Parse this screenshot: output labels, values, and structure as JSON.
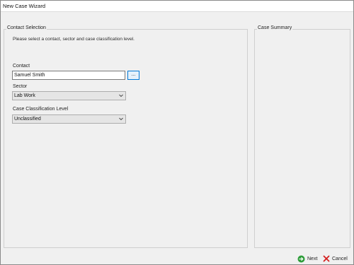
{
  "window": {
    "title": "New Case Wizard"
  },
  "contact_section": {
    "title": "Contact Selection",
    "instruction": "Please select a contact, sector and case classification level.",
    "contact_label": "Contact",
    "contact_value": "Samuel Smith",
    "browse_label": "...",
    "sector_label": "Sector",
    "sector_value": "Lab Work",
    "classification_label": "Case Classification Level",
    "classification_value": "Unclassified"
  },
  "summary_section": {
    "title": "Case Summary"
  },
  "footer": {
    "next_label": "Next",
    "cancel_label": "Cancel"
  },
  "colors": {
    "next_icon": "#2e9d3a",
    "cancel_icon": "#d42020",
    "focus_border": "#0078d7"
  }
}
